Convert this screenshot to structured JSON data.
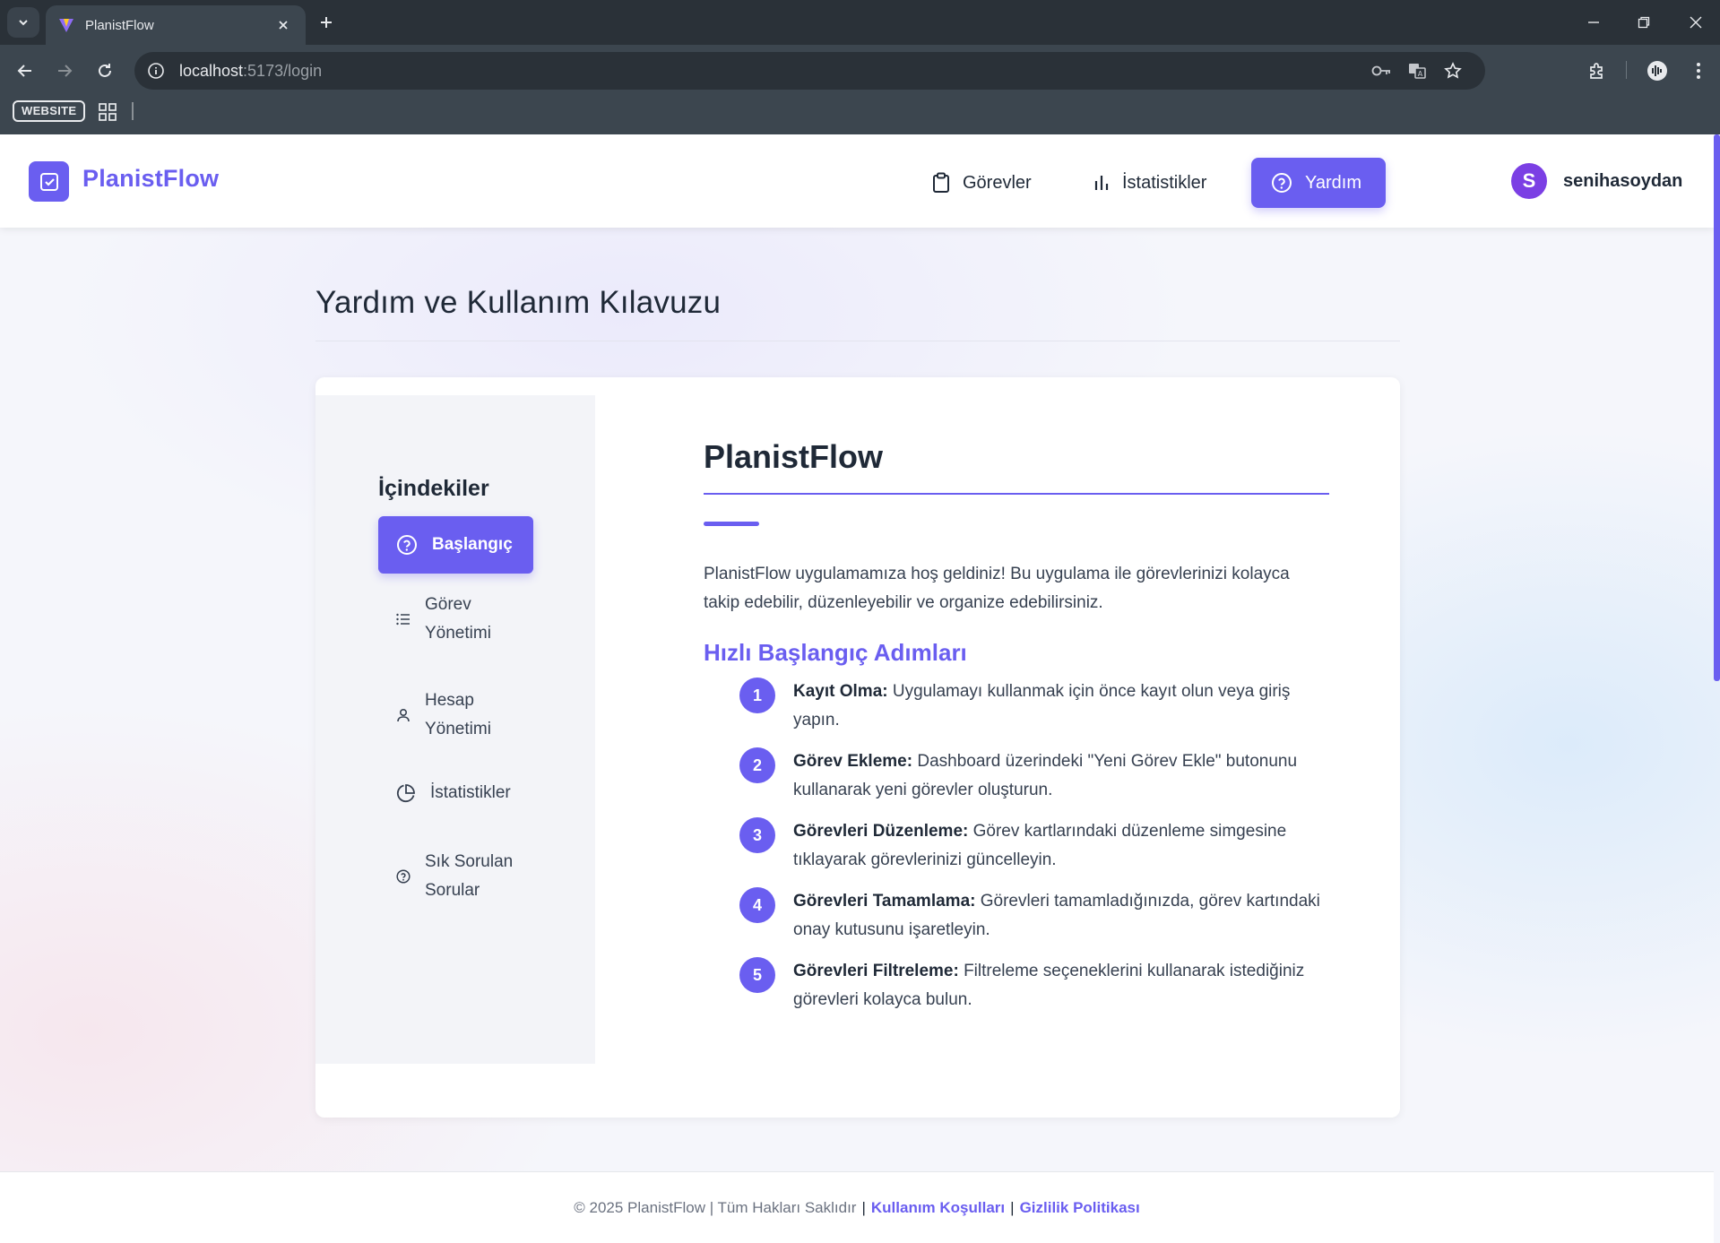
{
  "browser": {
    "tab_title": "PlanistFlow",
    "url_host": "localhost",
    "url_path": ":5173/login",
    "bookmark_label": "WEBSITE"
  },
  "header": {
    "brand": "PlanistFlow",
    "nav": [
      {
        "label": "Görevler",
        "icon": "clipboard-icon"
      },
      {
        "label": "İstatistikler",
        "icon": "bar-chart-icon"
      },
      {
        "label": "Yardım",
        "icon": "help-circle-icon",
        "active": true
      }
    ],
    "user": {
      "initial": "S",
      "name": "senihasoydan"
    }
  },
  "page": {
    "title": "Yardım ve Kullanım Kılavuzu"
  },
  "toc": {
    "title": "İçindekiler",
    "items": [
      {
        "label": "Başlangıç",
        "icon": "help-circle-icon",
        "active": true
      },
      {
        "label": "Görev Yönetimi",
        "icon": "list-icon"
      },
      {
        "label": "Hesap Yönetimi",
        "icon": "user-icon"
      },
      {
        "label": "İstatistikler",
        "icon": "pie-chart-icon"
      },
      {
        "label": "Sık Sorulan Sorular",
        "icon": "question-icon"
      }
    ]
  },
  "content": {
    "title": "PlanistFlow",
    "intro": "PlanistFlow uygulamamıza hoş geldiniz! Bu uygulama ile görevlerinizi kolayca takip edebilir, düzenleyebilir ve organize edebilirsiniz.",
    "subtitle": "Hızlı Başlangıç Adımları",
    "steps": [
      {
        "num": "1",
        "title": "Kayıt Olma:",
        "text": " Uygulamayı kullanmak için önce kayıt olun veya giriş yapın."
      },
      {
        "num": "2",
        "title": "Görev Ekleme:",
        "text": " Dashboard üzerindeki \"Yeni Görev Ekle\" butonunu kullanarak yeni görevler oluşturun."
      },
      {
        "num": "3",
        "title": "Görevleri Düzenleme:",
        "text": " Görev kartlarındaki düzenleme simgesine tıklayarak görevlerinizi güncelleyin."
      },
      {
        "num": "4",
        "title": "Görevleri Tamamlama:",
        "text": " Görevleri tamamladığınızda, görev kartındaki onay kutusunu işaretleyin."
      },
      {
        "num": "5",
        "title": "Görevleri Filtreleme:",
        "text": " Filtreleme seçeneklerini kullanarak istediğiniz görevleri kolayca bulun."
      }
    ]
  },
  "footer": {
    "copyright": "© 2025 PlanistFlow | Tüm Hakları Saklıdır",
    "sep": "|",
    "terms": "Kullanım Koşulları",
    "privacy": "Gizlilik Politikası"
  },
  "colors": {
    "accent": "#6a5ef0",
    "avatar": "#7b3fe4",
    "chrome_dark": "#2a3138",
    "chrome": "#3c464f"
  }
}
